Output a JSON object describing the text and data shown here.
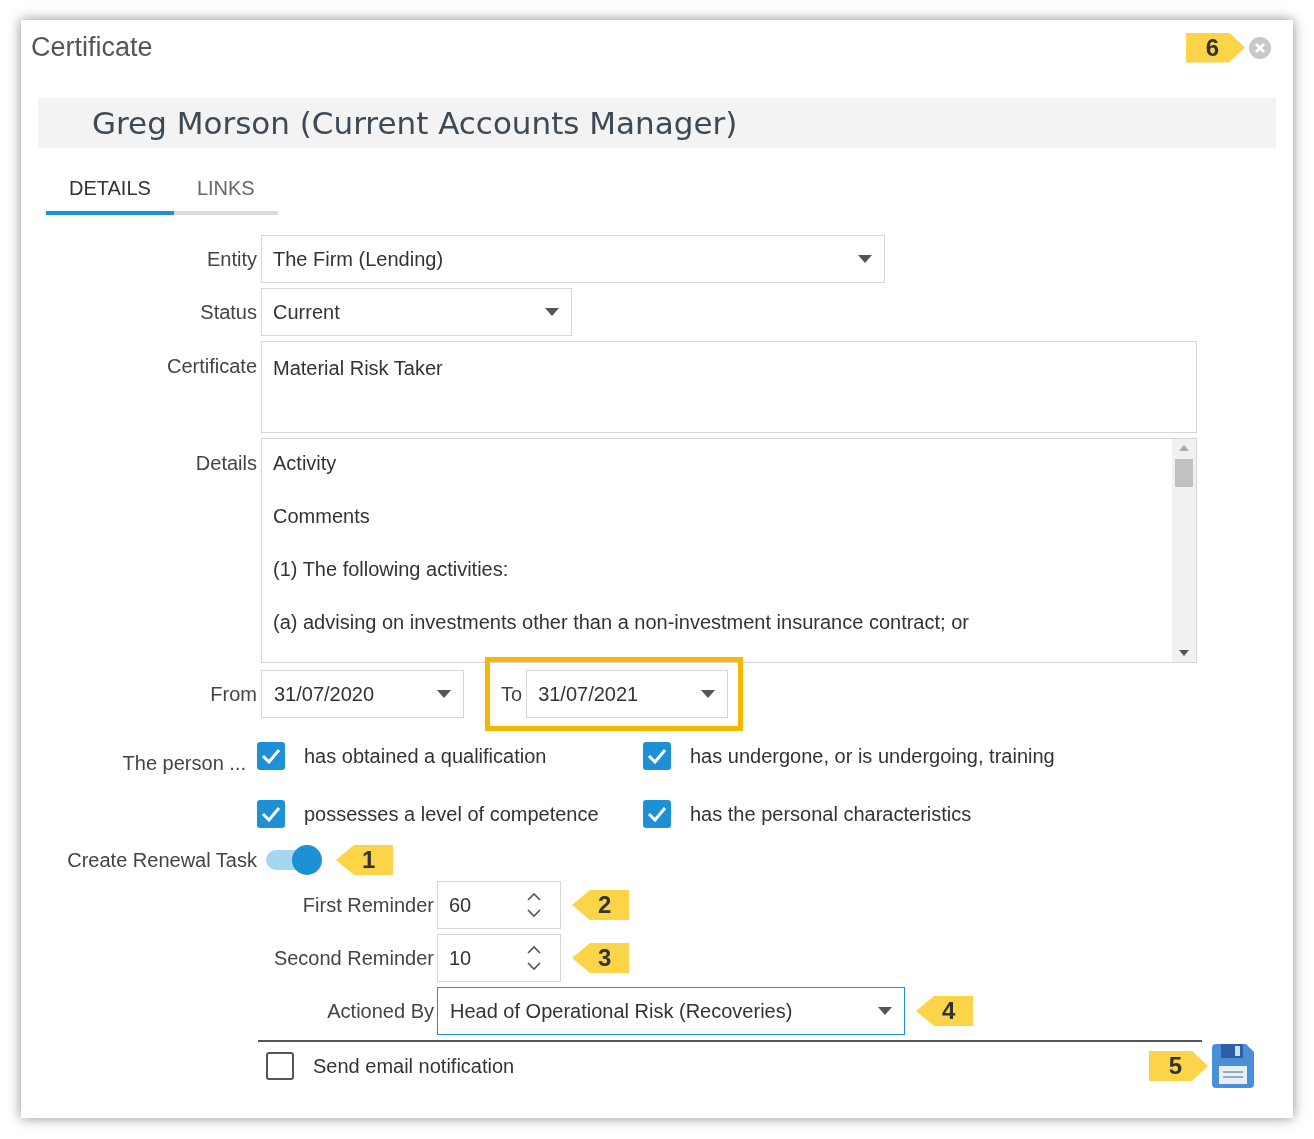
{
  "dialog": {
    "title": "Certificate",
    "close_callout": "6"
  },
  "header": "Greg Morson (Current Accounts Manager)",
  "tabs": [
    {
      "label": "DETAILS",
      "selected": true
    },
    {
      "label": "LINKS",
      "selected": false
    }
  ],
  "entity": {
    "label": "Entity",
    "value": "The Firm (Lending)"
  },
  "status": {
    "label": "Status",
    "value": "Current"
  },
  "certificate": {
    "label": "Certificate",
    "value": "Material Risk Taker"
  },
  "details": {
    "label": "Details",
    "lines": [
      "Activity",
      "Comments",
      "(1) The following activities:",
      "(a) advising on investments other than a non-investment insurance contract; or"
    ]
  },
  "from_date": {
    "label": "From",
    "value": "31/07/2020"
  },
  "to_date": {
    "label": "To",
    "value": "31/07/2021",
    "highlighted": true
  },
  "person": {
    "label": "The person ...",
    "options": [
      {
        "label": "has obtained a qualification",
        "checked": true
      },
      {
        "label": "has undergone, or is undergoing, training",
        "checked": true
      },
      {
        "label": "possesses a level of competence",
        "checked": true
      },
      {
        "label": "has the personal characteristics",
        "checked": true
      }
    ]
  },
  "renewal": {
    "label": "Create Renewal Task",
    "on": true,
    "callout": "1"
  },
  "first_reminder": {
    "label": "First Reminder",
    "value": "60",
    "callout": "2"
  },
  "second_reminder": {
    "label": "Second Reminder",
    "value": "10",
    "callout": "3"
  },
  "actioned_by": {
    "label": "Actioned By",
    "value": "Head of Operational Risk (Recoveries)",
    "callout": "4"
  },
  "send_email": {
    "label": "Send email notification",
    "checked": false
  },
  "save": {
    "callout": "5"
  }
}
